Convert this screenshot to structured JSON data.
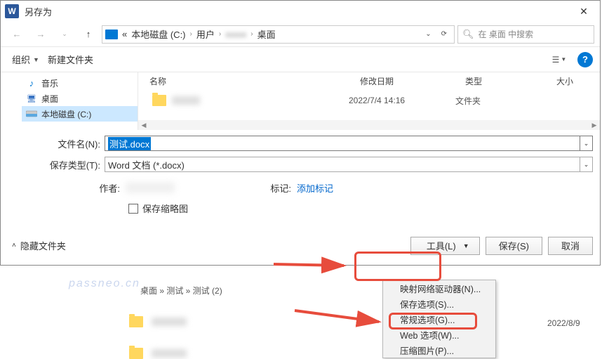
{
  "window": {
    "title": "另存为"
  },
  "path": {
    "segments": [
      "«",
      "本地磁盘 (C:)",
      "用户",
      "",
      "桌面"
    ],
    "blurred_index": 3
  },
  "search": {
    "placeholder": "在 桌面 中搜索"
  },
  "toolbar": {
    "organize": "组织",
    "newfolder": "新建文件夹"
  },
  "sidebar": {
    "items": [
      {
        "label": "音乐"
      },
      {
        "label": "桌面"
      },
      {
        "label": "本地磁盘 (C:)"
      }
    ]
  },
  "columns": {
    "name": "名称",
    "date": "修改日期",
    "type": "类型",
    "size": "大小"
  },
  "files": [
    {
      "name": "",
      "date": "2022/7/4 14:16",
      "type": "文件夹"
    }
  ],
  "fields": {
    "filename_label": "文件名(N):",
    "filename_value": "测试.docx",
    "filetype_label": "保存类型(T):",
    "filetype_value": "Word 文档 (*.docx)",
    "author_label": "作者:",
    "tags_label": "标记:",
    "tags_value": "添加标记",
    "thumbnail_label": "保存缩略图"
  },
  "footer": {
    "hide": "隐藏文件夹",
    "tools": "工具(L)",
    "save": "保存(S)",
    "cancel": "取消"
  },
  "menu": {
    "items": [
      "映射网络驱动器(N)...",
      "保存选项(S)...",
      "常规选项(G)...",
      "Web 选项(W)...",
      "压缩图片(P)..."
    ]
  },
  "background": {
    "breadcrumb": "桌面 » 测试 » 测试 (2)",
    "date": "2022/8/9"
  },
  "watermark": "passneo.cn"
}
